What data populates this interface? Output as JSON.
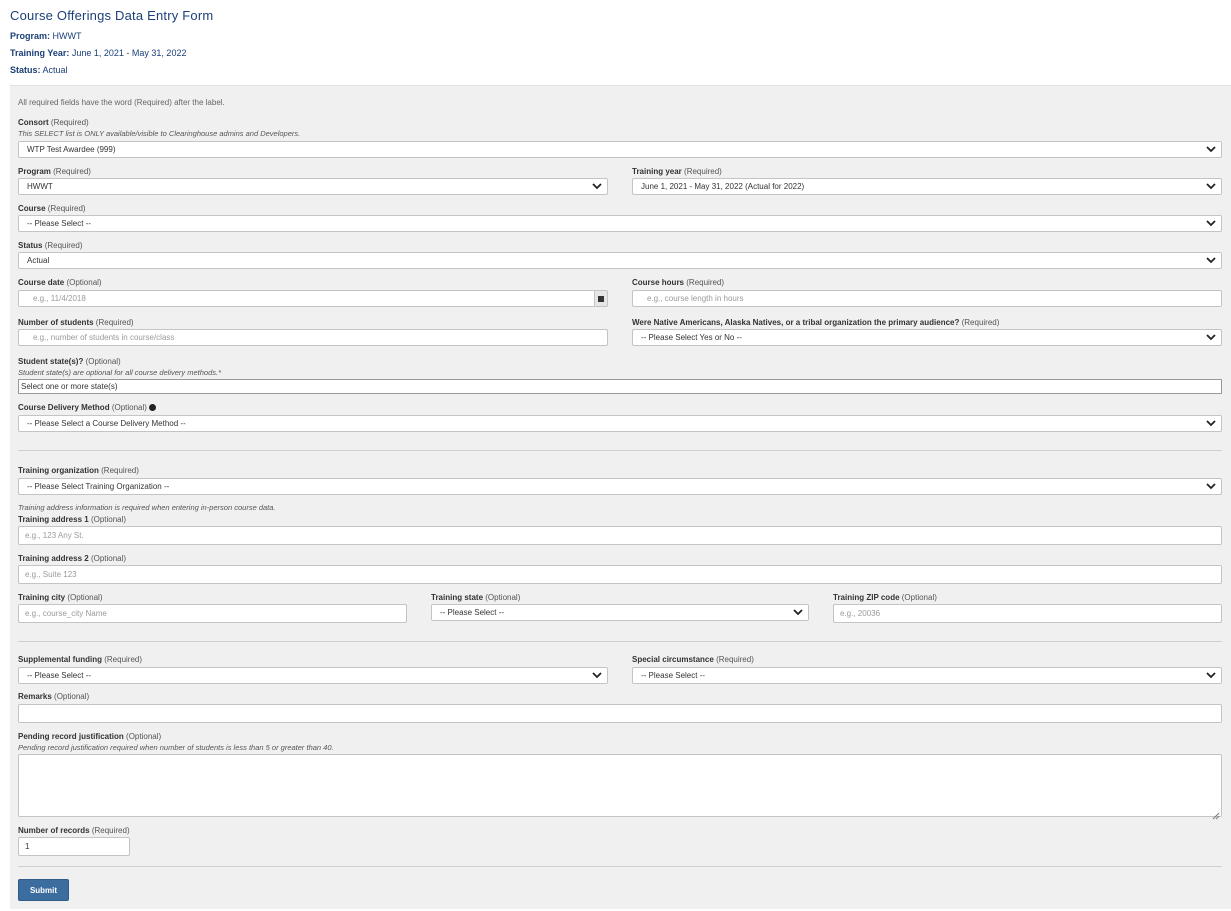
{
  "header": {
    "title": "Course Offerings Data Entry Form",
    "program_label": "Program:",
    "program_value": "HWWT",
    "training_year_label": "Training Year:",
    "training_year_value": "June 1, 2021 - May 31, 2022",
    "status_label": "Status:",
    "status_value": "Actual"
  },
  "form": {
    "required_note": "All required fields have the word (Required) after the label.",
    "consort": {
      "label": "Consort",
      "tag": "(Required)",
      "help": "This SELECT list is ONLY available/visible to Clearinghouse admins and Developers.",
      "value": "WTP Test Awardee (999)"
    },
    "program": {
      "label": "Program",
      "tag": "(Required)",
      "value": "HWWT"
    },
    "training_year": {
      "label": "Training year",
      "tag": "(Required)",
      "value": "June 1, 2021 - May 31, 2022 (Actual for 2022)"
    },
    "course": {
      "label": "Course",
      "tag": "(Required)",
      "value": "-- Please Select --"
    },
    "status": {
      "label": "Status",
      "tag": "(Required)",
      "value": "Actual"
    },
    "course_date": {
      "label": "Course date",
      "tag": "(Optional)",
      "placeholder": "e.g., 11/4/2018"
    },
    "course_hours": {
      "label": "Course hours",
      "tag": "(Required)",
      "placeholder": "e.g., course length in hours"
    },
    "num_students": {
      "label": "Number of students",
      "tag": "(Required)",
      "placeholder": "e.g., number of students in course/class"
    },
    "native_audience": {
      "label": "Were Native Americans, Alaska Natives, or a tribal organization the primary audience?",
      "tag": "(Required)",
      "value": "-- Please Select Yes or No --"
    },
    "student_states": {
      "label": "Student state(s)?",
      "tag": "(Optional)",
      "help": "Student state(s) are optional for all course delivery methods.*",
      "value": "Select one or more state(s)"
    },
    "delivery_method": {
      "label": "Course Delivery Method",
      "tag": "(Optional)",
      "value": "-- Please Select a Course Delivery Method --"
    },
    "training_org": {
      "label": "Training organization",
      "tag": "(Required)",
      "value": "-- Please Select Training Organization --"
    },
    "address_help": "Training address information is required when entering in-person course data.",
    "address1": {
      "label": "Training address 1",
      "tag": "(Optional)",
      "placeholder": "e.g., 123 Any St."
    },
    "address2": {
      "label": "Training address 2",
      "tag": "(Optional)",
      "placeholder": "e.g., Suite 123"
    },
    "city": {
      "label": "Training city",
      "tag": "(Optional)",
      "placeholder": "e.g., course_city Name"
    },
    "state": {
      "label": "Training state",
      "tag": "(Optional)",
      "value": "-- Please Select --"
    },
    "zip": {
      "label": "Training ZIP code",
      "tag": "(Optional)",
      "placeholder": "e.g., 20036"
    },
    "supplemental": {
      "label": "Supplemental funding",
      "tag": "(Required)",
      "value": "-- Please Select --"
    },
    "special": {
      "label": "Special circumstance",
      "tag": "(Required)",
      "value": "-- Please Select --"
    },
    "remarks": {
      "label": "Remarks",
      "tag": "(Optional)"
    },
    "pending": {
      "label": "Pending record justification",
      "tag": "(Optional)",
      "help": "Pending record justification required when number of students is less than 5 or greater than 40."
    },
    "num_records": {
      "label": "Number of records",
      "tag": "(Required)",
      "value": "1"
    },
    "submit_label": "Submit"
  }
}
